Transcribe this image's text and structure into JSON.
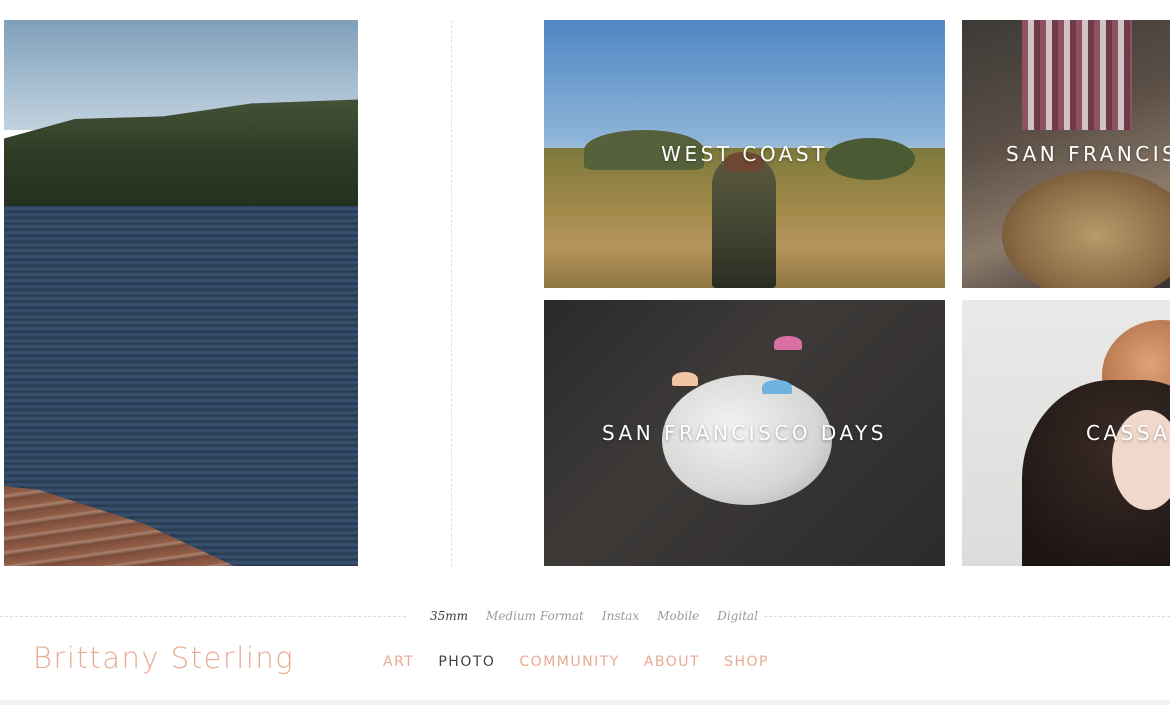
{
  "tiles": [
    {
      "caption": "WEST COAST"
    },
    {
      "caption": "SAN FRANCISCO"
    },
    {
      "caption": "SAN FRANCISCO DAYS"
    },
    {
      "caption": "CASSA"
    }
  ],
  "subnav": {
    "items": [
      "35mm",
      "Medium Format",
      "Instax",
      "Mobile",
      "Digital"
    ],
    "active": "35mm"
  },
  "brand": {
    "name": "Brittany Sterling"
  },
  "mainnav": {
    "items": [
      "ART",
      "PHOTO",
      "COMMUNITY",
      "ABOUT",
      "SHOP"
    ],
    "active": "PHOTO"
  },
  "colors": {
    "accent": "#e8aa93",
    "active_text": "#444444",
    "muted_text": "#9b9b9b"
  }
}
